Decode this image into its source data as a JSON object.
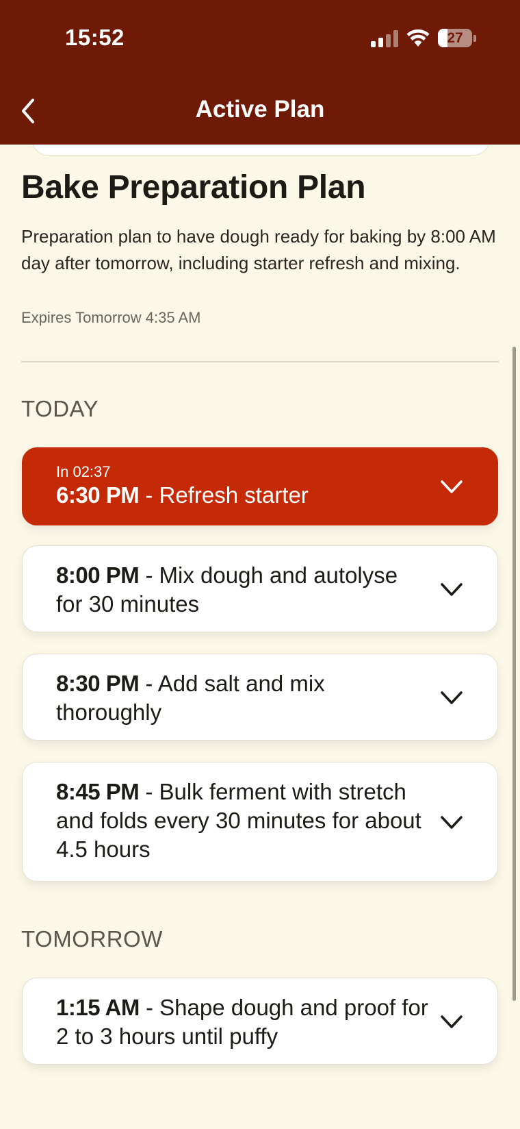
{
  "status_bar": {
    "time": "15:52",
    "battery": "27"
  },
  "nav": {
    "title": "Active Plan"
  },
  "plan": {
    "title": "Bake Preparation Plan",
    "description": "Preparation plan to have dough ready for baking by 8:00 AM day after tomorrow, including starter refresh and mixing.",
    "expires": "Expires Tomorrow 4:35 AM"
  },
  "sections": {
    "today": "TODAY",
    "tomorrow": "TOMORROW"
  },
  "steps": [
    {
      "countdown": "In 02:37",
      "time": "6:30 PM",
      "sep": " - ",
      "task": "Refresh starter",
      "active": true
    },
    {
      "time": "8:00 PM",
      "sep": " - ",
      "task": "Mix dough and autolyse for 30 minutes"
    },
    {
      "time": "8:30 PM",
      "sep": " - ",
      "task": "Add salt and mix thoroughly"
    },
    {
      "time": "8:45 PM",
      "sep": " - ",
      "task": "Bulk ferment with stretch and folds every 30 minutes for about 4.5 hours"
    },
    {
      "time": "1:15 AM",
      "sep": " - ",
      "task": "Shape dough and proof for 2 to 3 hours until puffy"
    }
  ],
  "colors": {
    "header": "#6e1a06",
    "accent": "#c42a06",
    "background": "#fbf8e8"
  },
  "icons": {
    "back": "chevron-left-icon",
    "expand": "chevron-down-icon",
    "wifi": "wifi-icon",
    "signal": "signal-icon",
    "battery": "battery-icon"
  }
}
